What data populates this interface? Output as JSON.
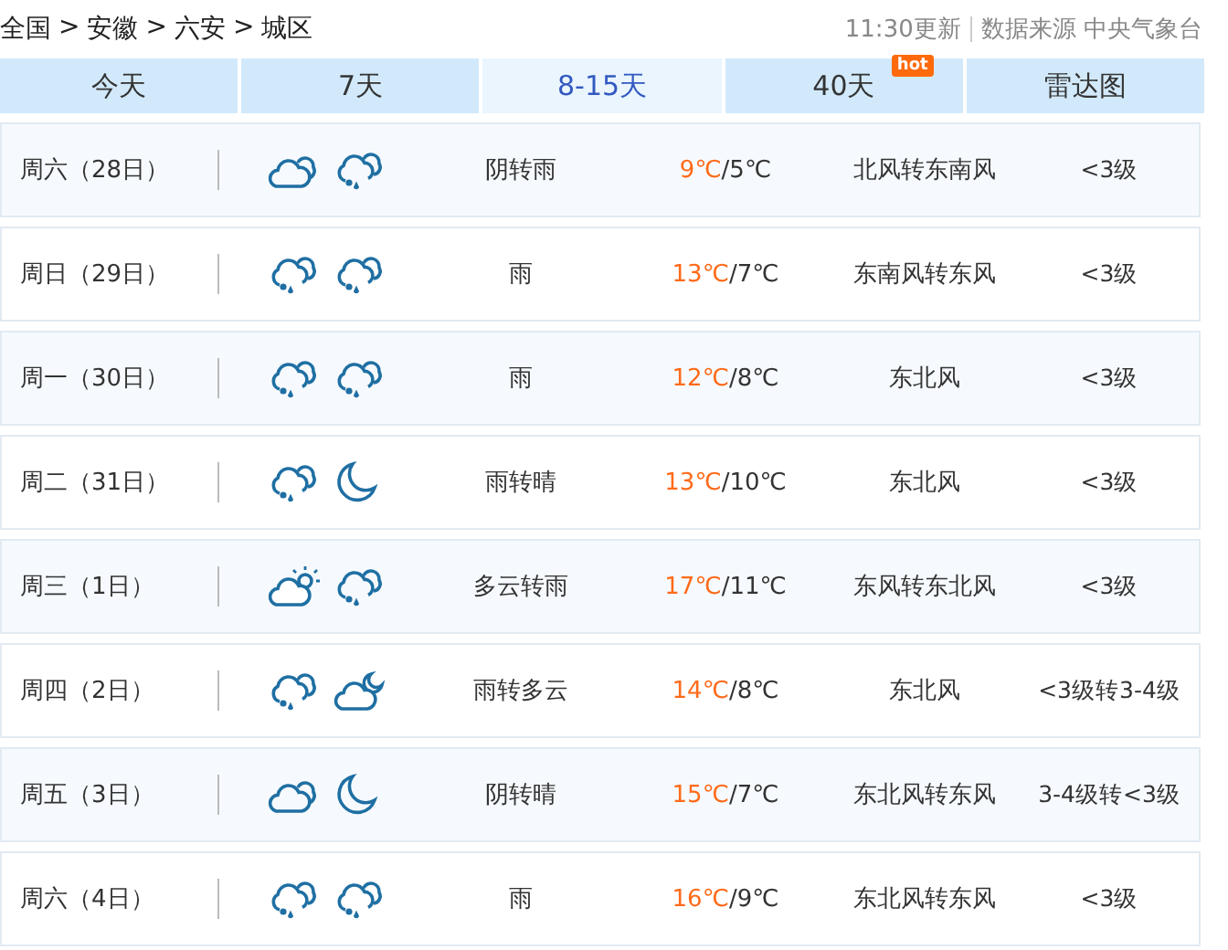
{
  "breadcrumb": {
    "items": [
      "全国",
      "安徽",
      "六安",
      "城区"
    ],
    "separator": ">"
  },
  "update_time": "11:30更新",
  "source": "数据来源 中央气象台",
  "tabs": [
    {
      "label": "今天",
      "selected": false
    },
    {
      "label": "7天",
      "selected": false
    },
    {
      "label": "8-15天",
      "selected": true
    },
    {
      "label": "40天",
      "selected": false,
      "badge": "hot"
    },
    {
      "label": "雷达图",
      "selected": false
    }
  ],
  "temp_separator": "/",
  "days": [
    {
      "date": "周六（28日）",
      "icons": [
        {
          "kind": "cloudy"
        },
        {
          "kind": "rain"
        }
      ],
      "weather": "阴转雨",
      "high": "9℃",
      "low": "5℃",
      "wind": "北风转东南风",
      "force": "<3级"
    },
    {
      "date": "周日（29日）",
      "icons": [
        {
          "kind": "rain"
        },
        {
          "kind": "rain"
        }
      ],
      "weather": "雨",
      "high": "13℃",
      "low": "7℃",
      "wind": "东南风转东风",
      "force": "<3级"
    },
    {
      "date": "周一（30日）",
      "icons": [
        {
          "kind": "rain"
        },
        {
          "kind": "rain"
        }
      ],
      "weather": "雨",
      "high": "12℃",
      "low": "8℃",
      "wind": "东北风",
      "force": "<3级"
    },
    {
      "date": "周二（31日）",
      "icons": [
        {
          "kind": "rain"
        },
        {
          "kind": "moon"
        }
      ],
      "weather": "雨转晴",
      "high": "13℃",
      "low": "10℃",
      "wind": "东北风",
      "force": "<3级"
    },
    {
      "date": "周三（1日）",
      "icons": [
        {
          "kind": "suncloud"
        },
        {
          "kind": "rain"
        }
      ],
      "weather": "多云转雨",
      "high": "17℃",
      "low": "11℃",
      "wind": "东风转东北风",
      "force": "<3级"
    },
    {
      "date": "周四（2日）",
      "icons": [
        {
          "kind": "rain"
        },
        {
          "kind": "mooncloud"
        }
      ],
      "weather": "雨转多云",
      "high": "14℃",
      "low": "8℃",
      "wind": "东北风",
      "force": "<3级转3-4级"
    },
    {
      "date": "周五（3日）",
      "icons": [
        {
          "kind": "cloudy"
        },
        {
          "kind": "moon"
        }
      ],
      "weather": "阴转晴",
      "high": "15℃",
      "low": "7℃",
      "wind": "东北风转东风",
      "force": "3-4级转<3级"
    },
    {
      "date": "周六（4日）",
      "icons": [
        {
          "kind": "rain"
        },
        {
          "kind": "rain"
        }
      ],
      "weather": "雨",
      "high": "16℃",
      "low": "9℃",
      "wind": "东北风转东风",
      "force": "<3级"
    }
  ]
}
